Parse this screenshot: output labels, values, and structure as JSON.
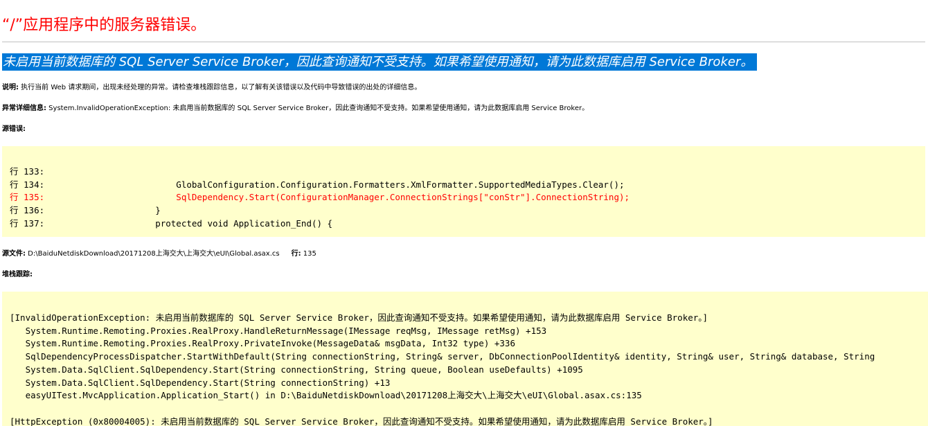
{
  "page": {
    "title": "“/”应用程序中的服务器错误。",
    "error_message": "未启用当前数据库的 SQL Server Service Broker，因此查询通知不受支持。如果希望使用通知，请为此数据库启用 Service Broker。"
  },
  "description": {
    "label": "说明:",
    "text": " 执行当前 Web 请求期间，出现未经处理的异常。请检查堆栈跟踪信息，以了解有关该错误以及代码中导致错误的出处的详细信息。"
  },
  "exception_details": {
    "label": "异常详细信息:",
    "text": " System.InvalidOperationException: 未启用当前数据库的 SQL Server Service Broker，因此查询通知不受支持。如果希望使用通知，请为此数据库启用 Service Broker。"
  },
  "source_error": {
    "label": "源错误:",
    "lines": [
      {
        "number": "行 133:",
        "code": ""
      },
      {
        "number": "行 134:",
        "code": "            GlobalConfiguration.Configuration.Formatters.XmlFormatter.SupportedMediaTypes.Clear();"
      },
      {
        "number": "行 135:",
        "code": "            SqlDependency.Start(ConfigurationManager.ConnectionStrings[\"conStr\"].ConnectionString);"
      },
      {
        "number": "行 136:",
        "code": "        }"
      },
      {
        "number": "行 137:",
        "code": "        protected void Application_End() {"
      }
    ]
  },
  "source_file": {
    "label": "源文件:",
    "path": " D:\\BaiduNetdiskDownload\\20171208上海交大\\上海交大\\eUI\\Global.asax.cs",
    "line_label": "行:",
    "line_value": " 135"
  },
  "stack_trace": {
    "label": "堆栈跟踪:",
    "lines": [
      "[InvalidOperationException: 未启用当前数据库的 SQL Server Service Broker，因此查询通知不受支持。如果希望使用通知，请为此数据库启用 Service Broker。]",
      "   System.Runtime.Remoting.Proxies.RealProxy.HandleReturnMessage(IMessage reqMsg, IMessage retMsg) +153",
      "   System.Runtime.Remoting.Proxies.RealProxy.PrivateInvoke(MessageData& msgData, Int32 type) +336",
      "   SqlDependencyProcessDispatcher.StartWithDefault(String connectionString, String& server, DbConnectionPoolIdentity& identity, String& user, String& database, String",
      "   System.Data.SqlClient.SqlDependency.Start(String connectionString, String queue, Boolean useDefaults) +1095",
      "   System.Data.SqlClient.SqlDependency.Start(String connectionString) +13",
      "   easyUITest.MvcApplication.Application_Start() in D:\\BaiduNetdiskDownload\\20171208上海交大\\上海交大\\eUI\\Global.asax.cs:135",
      "",
      "[HttpException (0x80004005): 未启用当前数据库的 SQL Server Service Broker，因此查询通知不受支持。如果希望使用通知，请为此数据库启用 Service Broker。]"
    ]
  },
  "colors": {
    "title_red": "#ff0000",
    "selection_blue": "#0078d7",
    "code_background": "#ffffcc",
    "rule_gray": "#c0c0c0"
  }
}
